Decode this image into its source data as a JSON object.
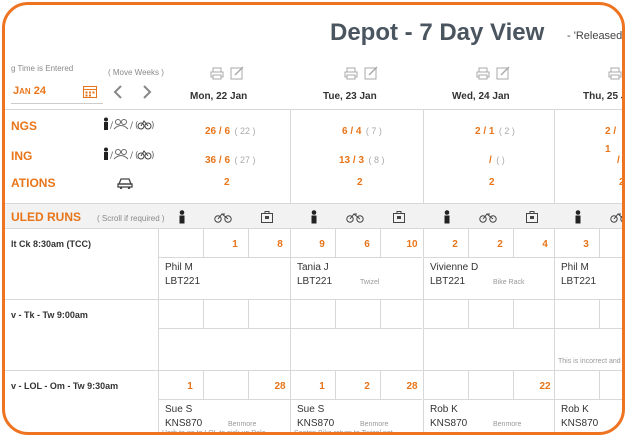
{
  "header": {
    "title": "Depot - 7 Day View",
    "subtitle": "- 'Released",
    "time_hint": "g Time is Entered",
    "move_weeks": "( Move Weeks )",
    "date_value": "Jan 24"
  },
  "days": [
    {
      "label": "Mon, 22 Jan"
    },
    {
      "label": "Tue, 23 Jan"
    },
    {
      "label": "Wed, 24 Jan"
    },
    {
      "label": "Thu, 25 J"
    }
  ],
  "summary_rows": [
    {
      "label": "NGS",
      "cells": [
        {
          "main": "26 / 6",
          "sub": "( 22 )"
        },
        {
          "main": "6 / 4",
          "sub": "( 7 )"
        },
        {
          "main": "2 / 1",
          "sub": "( 2 )"
        },
        {
          "main": "2 / 1",
          "sub": ""
        }
      ]
    },
    {
      "label": "ING",
      "cells": [
        {
          "main": "36 / 6",
          "sub": "( 27 )"
        },
        {
          "main": "13 / 3",
          "sub": "( 8 )"
        },
        {
          "main": "/",
          "sub": "( )"
        },
        {
          "main": "/",
          "sub": ""
        }
      ]
    },
    {
      "label": "ATIONS",
      "cells": [
        {
          "main": "2",
          "sub": ""
        },
        {
          "main": "2",
          "sub": ""
        },
        {
          "main": "2",
          "sub": ""
        },
        {
          "main": "2",
          "sub": ""
        }
      ]
    }
  ],
  "scheduled": {
    "label": "ULED RUNS",
    "hint": "( Scroll if required )"
  },
  "runs": [
    {
      "label": "lt Ck 8:30am (TCC)",
      "days": [
        {
          "nums": [
            "",
            "1",
            "8"
          ],
          "driver": "Phil M",
          "vehicle": "LBT221",
          "location": "",
          "note": ""
        },
        {
          "nums": [
            "9",
            "6",
            "10"
          ],
          "driver": "Tania J",
          "vehicle": "LBT221",
          "location": "Twizel",
          "note": ""
        },
        {
          "nums": [
            "2",
            "2",
            "4"
          ],
          "driver": "Vivienne D",
          "vehicle": "LBT221",
          "location": "Bike Rack",
          "note": ""
        },
        {
          "nums": [
            "3",
            "",
            ""
          ],
          "driver": "Phil M",
          "vehicle": "LBT221",
          "location": "",
          "note": ""
        }
      ]
    },
    {
      "label": "v - Tk - Tw 9:00am",
      "days": [
        {
          "nums": [
            "",
            "",
            ""
          ],
          "driver": "",
          "vehicle": "",
          "location": "",
          "note": ""
        },
        {
          "nums": [
            "",
            "",
            ""
          ],
          "driver": "",
          "vehicle": "",
          "location": "",
          "note": ""
        },
        {
          "nums": [
            "",
            "",
            ""
          ],
          "driver": "",
          "vehicle": "",
          "location": "",
          "note": ""
        },
        {
          "nums": [
            "",
            "",
            ""
          ],
          "driver": "",
          "vehicle": "",
          "location": "",
          "note": "This is incorrect and"
        }
      ]
    },
    {
      "label": "v - LOL - Om - Tw 9:30am",
      "days": [
        {
          "nums": [
            "1",
            "",
            "28"
          ],
          "driver": "Sue S",
          "vehicle": "KNS870",
          "location": "Benmore",
          "note": "Herb to go to LOL to pick up Relo"
        },
        {
          "nums": [
            "1",
            "2",
            "28"
          ],
          "driver": "Sue S",
          "vehicle": "KNS870",
          "location": "Benmore",
          "note": "Seaton Bike return to Twizel not"
        },
        {
          "nums": [
            "",
            "",
            "22"
          ],
          "driver": "Rob K",
          "vehicle": "KNS870",
          "location": "Benmore",
          "note": ""
        },
        {
          "nums": [
            "",
            "",
            ""
          ],
          "driver": "Rob K",
          "vehicle": "KNS870",
          "location": "",
          "note": ""
        }
      ]
    }
  ],
  "colors": {
    "accent": "#e8751a",
    "frame": "#ee7421",
    "title": "#4a5560"
  }
}
